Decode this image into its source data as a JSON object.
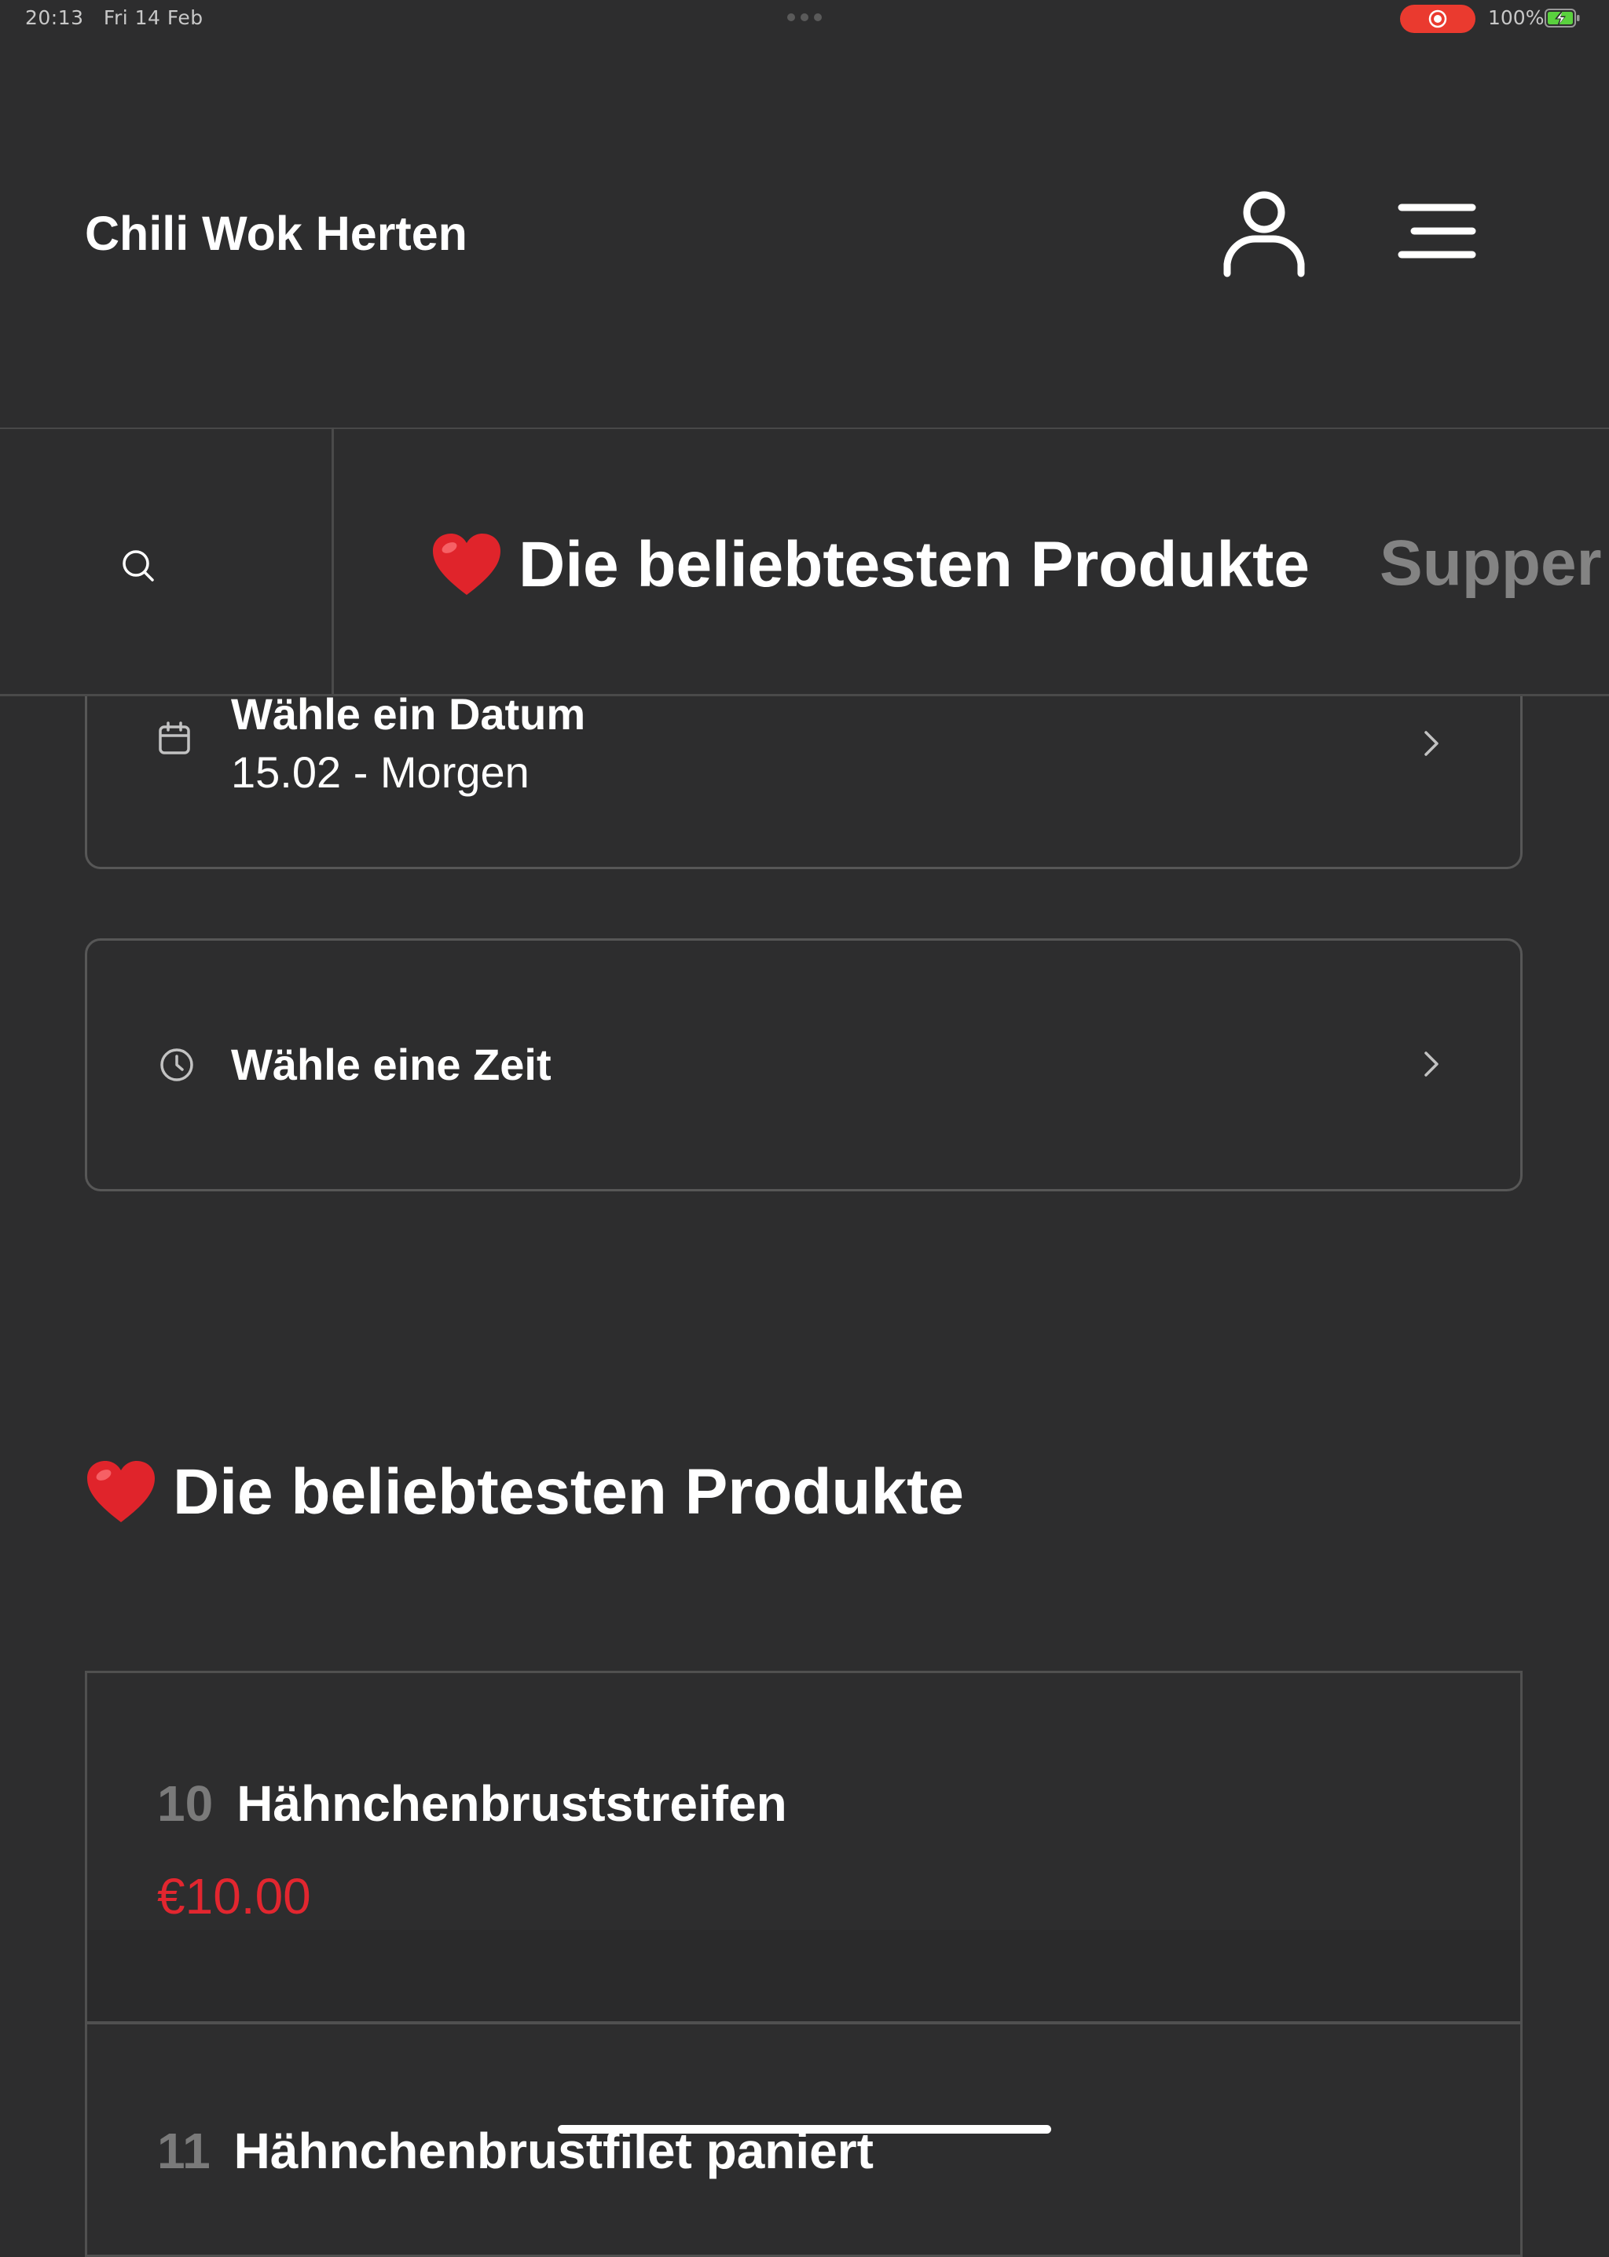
{
  "status_bar": {
    "time": "20:13",
    "date": "Fri 14 Feb",
    "battery": "100%"
  },
  "header": {
    "brand": "Chili Wok Herten",
    "icons": [
      "user-icon",
      "menu-icon"
    ]
  },
  "category_bar": {
    "active": {
      "emoji": "❤️",
      "label": "Die beliebtesten Produkte"
    },
    "next_label": "Supper"
  },
  "date_picker": {
    "title": "Wähle ein Datum",
    "value": "15.02 - Morgen"
  },
  "time_picker": {
    "title": "Wähle eine Zeit"
  },
  "section": {
    "emoji": "❤️",
    "title": "Die beliebtesten Produkte"
  },
  "products": [
    {
      "number": "10",
      "name": "Hähnchenbruststreifen",
      "price": "€10.00"
    },
    {
      "number": "11",
      "name": "Hähnchenbrustfilet paniert",
      "price": ""
    }
  ],
  "colors": {
    "background": "#2d2d2e",
    "price": "#e2262f",
    "record": "#ea3a2f",
    "battery": "#5ad13e"
  }
}
